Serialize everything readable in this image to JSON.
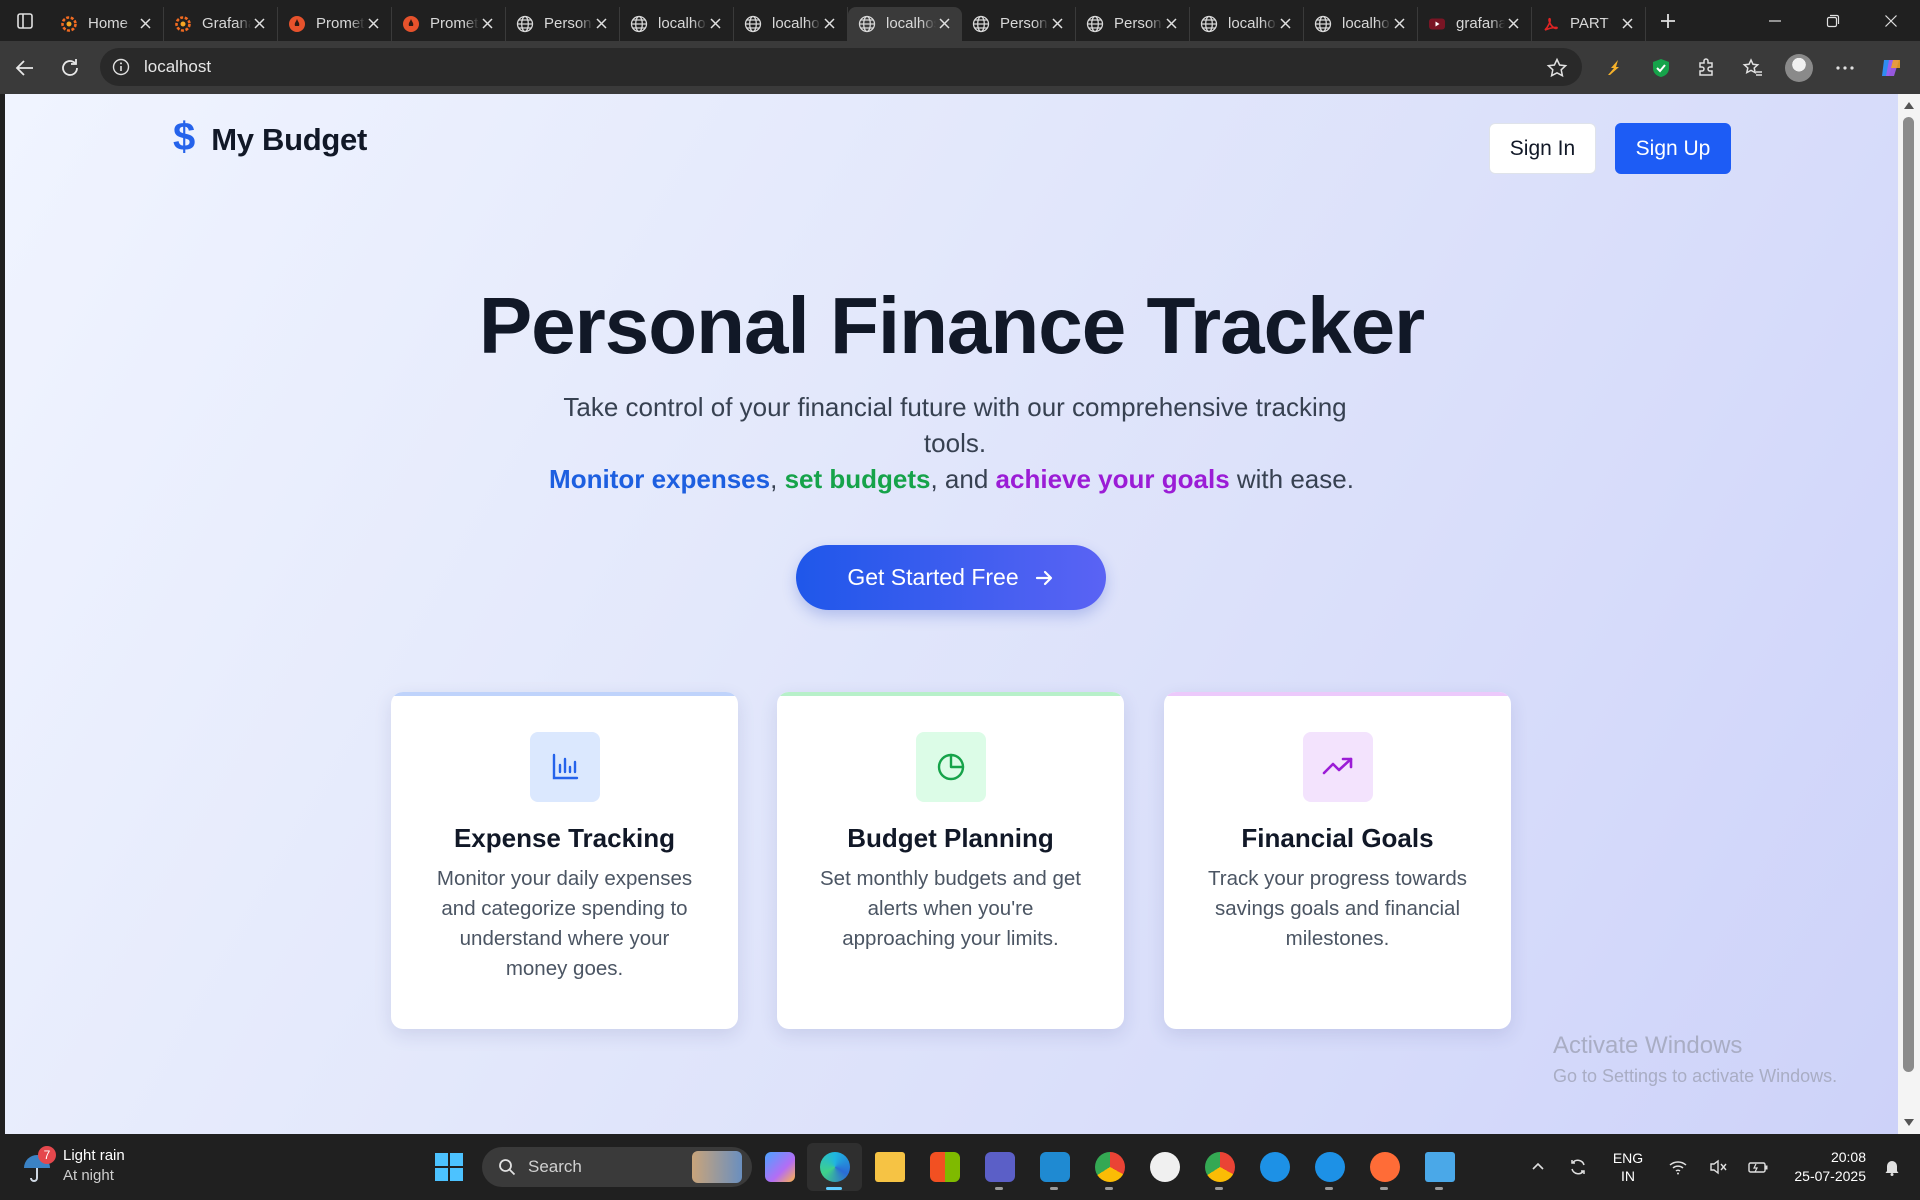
{
  "browser": {
    "tabs": [
      {
        "label": "Home",
        "icon": "grafana-icon",
        "active": false
      },
      {
        "label": "Grafana",
        "icon": "grafana-icon",
        "active": false
      },
      {
        "label": "Prometheus",
        "icon": "prometheus-icon",
        "active": false
      },
      {
        "label": "Prometheus",
        "icon": "prometheus-icon",
        "active": false
      },
      {
        "label": "Personal",
        "icon": "globe-icon",
        "active": false
      },
      {
        "label": "localhost",
        "icon": "globe-icon",
        "active": false
      },
      {
        "label": "localhost",
        "icon": "globe-icon",
        "active": false
      },
      {
        "label": "localhost",
        "icon": "globe-icon",
        "active": true
      },
      {
        "label": "Personal",
        "icon": "globe-icon",
        "active": false
      },
      {
        "label": "Personal",
        "icon": "globe-icon",
        "active": false
      },
      {
        "label": "localhost",
        "icon": "globe-icon",
        "active": false
      },
      {
        "label": "localhost",
        "icon": "globe-icon",
        "active": false
      },
      {
        "label": "grafana",
        "icon": "youtube-icon",
        "active": false
      },
      {
        "label": "PART",
        "icon": "pdf-icon",
        "active": false
      }
    ],
    "address": "localhost"
  },
  "page": {
    "brand": {
      "symbol": "$",
      "name": "My Budget"
    },
    "nav": {
      "signin_label": "Sign In",
      "signup_label": "Sign Up"
    },
    "hero": {
      "title": "Personal Finance Tracker",
      "subtitle": "Take control of your financial future with our comprehensive tracking tools.",
      "highlight_1": "Monitor expenses",
      "sep_1": ", ",
      "highlight_2": "set budgets",
      "sep_2": ", and ",
      "highlight_3": "achieve your goals",
      "tail": " with ease.",
      "cta_label": "Get Started Free"
    },
    "features": [
      {
        "title": "Expense Tracking",
        "description": "Monitor your daily expenses and categorize spending to understand where your money goes.",
        "icon": "bar-chart-icon",
        "accent": "#2563eb",
        "tint": "#dbe8fe",
        "line": "#bfd3fb"
      },
      {
        "title": "Budget Planning",
        "description": "Set monthly budgets and get alerts when you're approaching your limits.",
        "icon": "pie-chart-icon",
        "accent": "#16a34a",
        "tint": "#dcfce7",
        "line": "#b7f0c9"
      },
      {
        "title": "Financial Goals",
        "description": "Track your progress towards savings goals and financial milestones.",
        "icon": "trending-up-icon",
        "accent": "#9b1cd6",
        "tint": "#f3e3fd",
        "line": "#ecc9fb"
      }
    ]
  },
  "watermark": {
    "title": "Activate Windows",
    "subtitle": "Go to Settings to activate Windows."
  },
  "taskbar": {
    "weather": {
      "temp_badge": "7",
      "condition": "Light rain",
      "period": "At night"
    },
    "search_label": "Search",
    "language": {
      "line1": "ENG",
      "line2": "IN"
    },
    "clock": {
      "time": "20:08",
      "date": "25-07-2025"
    }
  },
  "colors": {
    "primary": "#1d5cf5",
    "title": "#111827"
  }
}
